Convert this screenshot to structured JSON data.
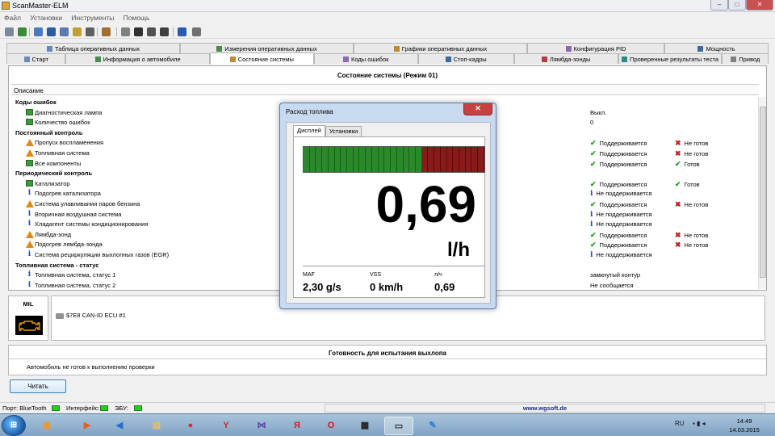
{
  "window": {
    "title": "ScanMaster-ELM",
    "buttons": {
      "min": "–",
      "max": "□",
      "close": "✕"
    }
  },
  "menu": [
    "Файл",
    "Установки",
    "Инструменты",
    "Помощь"
  ],
  "toolbar_icons": [
    "wrench-icon",
    "globe-icon",
    "gauge-icon",
    "table-icon",
    "grid-icon",
    "camera-icon",
    "scale-icon",
    "clipboard-icon",
    "comment-icon",
    "monitor-icon",
    "card-icon",
    "sphere-icon",
    "info-icon",
    "book-icon"
  ],
  "tabs_row1": [
    {
      "label": "Таблица оперативных данных",
      "icon": "table-icon"
    },
    {
      "label": "Измерения оперативных данных",
      "icon": "gauge-icon"
    },
    {
      "label": "Графики оперативных данных",
      "icon": "chart-icon"
    },
    {
      "label": "Конфигурация PID",
      "icon": "config-icon"
    },
    {
      "label": "Мощность",
      "icon": "power-icon"
    }
  ],
  "tabs_row2": [
    {
      "label": "Старт",
      "icon": "flag-icon"
    },
    {
      "label": "Информация о автомобиле",
      "icon": "info-icon"
    },
    {
      "label": "Состояние системы",
      "icon": "status-icon",
      "active": true
    },
    {
      "label": "Коды ошибок",
      "icon": "warning-icon"
    },
    {
      "label": "Стоп-кадры",
      "icon": "snapshot-icon"
    },
    {
      "label": "Лямбда-зонды",
      "icon": "sensor-icon"
    },
    {
      "label": "Проверенные результаты теста",
      "icon": "test-icon"
    },
    {
      "label": "Привод",
      "icon": "drive-icon"
    }
  ],
  "system": {
    "title": "Состояние системы (Режим 01)",
    "column_header": "Описание",
    "rows": [
      {
        "type": "section",
        "name": "Коды ошибок"
      },
      {
        "type": "item",
        "status": "ok",
        "name": "Диагностическая лампа",
        "c1": "Выкл."
      },
      {
        "type": "item",
        "status": "ok",
        "name": "Количество ошибок",
        "c1": "0"
      },
      {
        "type": "section",
        "name": "Постоянный контроль"
      },
      {
        "type": "item",
        "status": "warn",
        "name": "Пропуск воспламенения",
        "c1": "Поддерживается",
        "c1_icon": "check",
        "c2": "Не готов",
        "c2_icon": "cross"
      },
      {
        "type": "item",
        "status": "warn",
        "name": "Топливная система",
        "c1": "Поддерживается",
        "c1_icon": "check",
        "c2": "Не готов",
        "c2_icon": "cross"
      },
      {
        "type": "item",
        "status": "ok",
        "name": "Все компоненты",
        "c1": "Поддерживается",
        "c1_icon": "check",
        "c2": "Готов",
        "c2_icon": "check"
      },
      {
        "type": "section",
        "name": "Периодический контроль"
      },
      {
        "type": "item",
        "status": "ok",
        "name": "Катализатор",
        "c1": "Поддерживается",
        "c1_icon": "check",
        "c2": "Готов",
        "c2_icon": "check"
      },
      {
        "type": "item",
        "status": "info",
        "name": "Подогрев катализатора",
        "c1": "Не поддерживается",
        "c1_icon": "info"
      },
      {
        "type": "item",
        "status": "warn",
        "name": "Система улавливания паров бензина",
        "c1": "Поддерживается",
        "c1_icon": "check",
        "c2": "Не готов",
        "c2_icon": "cross"
      },
      {
        "type": "item",
        "status": "info",
        "name": "Вторичная воздушная система",
        "c1": "Не поддерживается",
        "c1_icon": "info"
      },
      {
        "type": "item",
        "status": "info",
        "name": "Хладагент системы кондиционирования",
        "c1": "Не поддерживается",
        "c1_icon": "info"
      },
      {
        "type": "item",
        "status": "warn",
        "name": "Лямбда-зонд",
        "c1": "Поддерживается",
        "c1_icon": "check",
        "c2": "Не готов",
        "c2_icon": "cross"
      },
      {
        "type": "item",
        "status": "warn",
        "name": "Подогрев лямбда-зонда",
        "c1": "Поддерживается",
        "c1_icon": "check",
        "c2": "Не готов",
        "c2_icon": "cross"
      },
      {
        "type": "item",
        "status": "info",
        "name": "Система рециркуляции выхлопных газов (EGR)",
        "c1": "Не поддерживается",
        "c1_icon": "info"
      },
      {
        "type": "section",
        "name": "Топливная система - статус"
      },
      {
        "type": "item",
        "status": "info",
        "name": "Топливная система, статус 1",
        "c1": "замкнутый контур"
      },
      {
        "type": "item",
        "status": "info",
        "name": "Топливная система, статус 2",
        "c1": "Не сообщается"
      }
    ]
  },
  "mil": {
    "label": "MIL"
  },
  "ecu": {
    "text": "$7E8   CAN-ID ECU #1"
  },
  "readiness": {
    "title": "Готовность для испытания выхлопа",
    "text": "Автомобиль не готов к выполнению проверки"
  },
  "read_button": "Читать",
  "status": {
    "port": "Порт: BlueTooth",
    "interface": "Интерфейс:",
    "ecu": "ЭБУ:",
    "url": "www.wgsoft.de",
    "led_color": "#20d020"
  },
  "fuel_dialog": {
    "title": "Расход топлива",
    "close": "✕",
    "tabs": [
      "Дисплей",
      "Установки"
    ],
    "bar": {
      "green_segments": 19,
      "red_segments": 10
    },
    "value": "0,69",
    "unit": "l/h",
    "metrics": [
      {
        "label": "MAF",
        "value": "2,30 g/s"
      },
      {
        "label": "VSS",
        "value": "0 km/h"
      },
      {
        "label": "л/ч",
        "value": "0,69"
      }
    ]
  },
  "taskbar": {
    "start_label": "⊞",
    "apps": [
      {
        "name": "explorer",
        "glyph": "▣",
        "color": "#e89a30"
      },
      {
        "name": "media-player",
        "glyph": "▶",
        "color": "#e06020"
      },
      {
        "name": "speaker",
        "glyph": "◀",
        "color": "#2a6ad0"
      },
      {
        "name": "folder",
        "glyph": "▤",
        "color": "#e8c060"
      },
      {
        "name": "chrome",
        "glyph": "●",
        "color": "#d03030"
      },
      {
        "name": "yandex-y",
        "glyph": "Y",
        "color": "#e02020"
      },
      {
        "name": "vs-app",
        "glyph": "⋈",
        "color": "#6a3aaa"
      },
      {
        "name": "yandex-ya",
        "glyph": "Я",
        "color": "#d02020"
      },
      {
        "name": "opera",
        "glyph": "O",
        "color": "#d01818"
      },
      {
        "name": "clapper",
        "glyph": "▦",
        "color": "#202020"
      },
      {
        "name": "scanmaster",
        "glyph": "▭",
        "color": "#303030",
        "active": true
      },
      {
        "name": "paint",
        "glyph": "✎",
        "color": "#2a7ad0"
      }
    ],
    "lang": "RU",
    "time": "14:49",
    "date": "14.03.2015"
  }
}
